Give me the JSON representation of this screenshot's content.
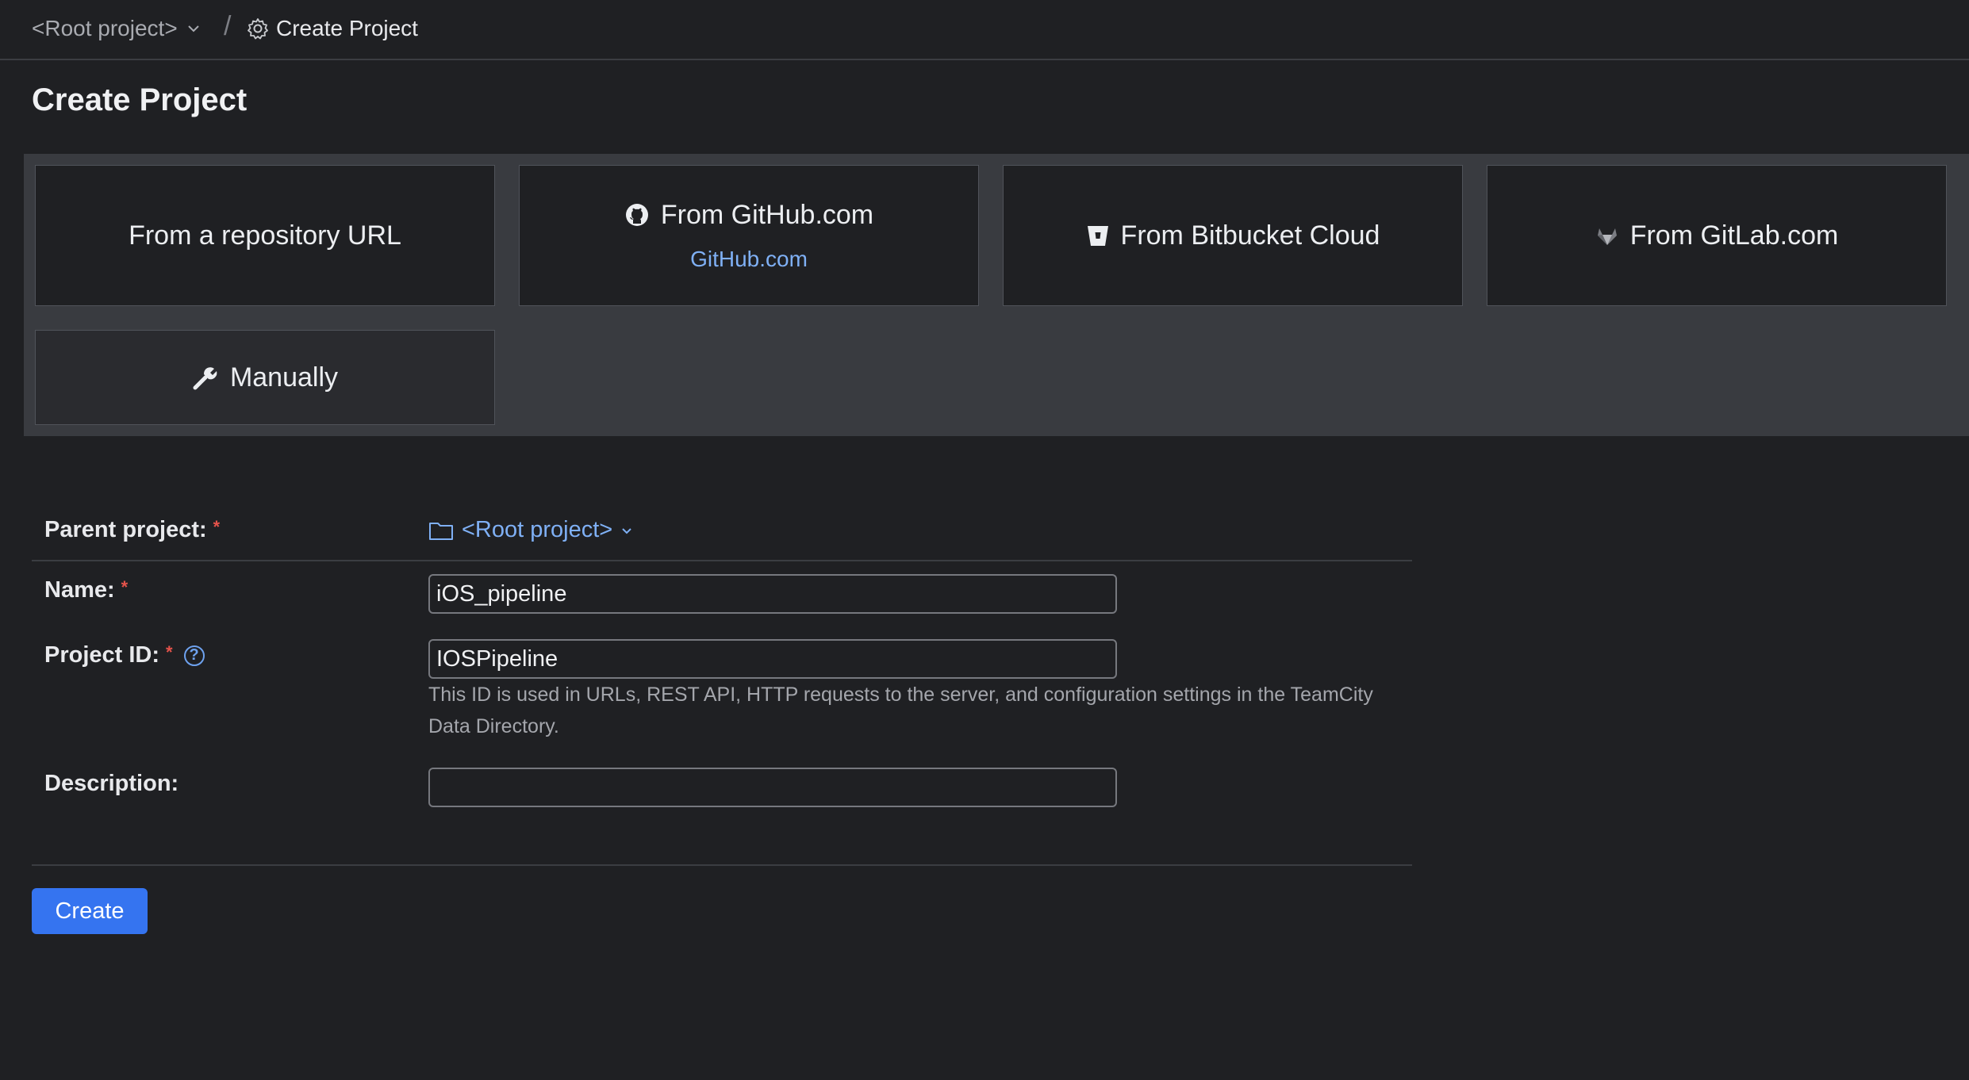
{
  "breadcrumb": {
    "root_label": "<Root project>",
    "separator": "/",
    "current_label": "Create Project"
  },
  "page": {
    "title": "Create Project"
  },
  "import_options": {
    "from_url": "From a repository URL",
    "github": {
      "label": "From GitHub.com",
      "sublabel": "GitHub.com"
    },
    "bitbucket": "From Bitbucket Cloud",
    "gitlab": "From GitLab.com",
    "manual": "Manually"
  },
  "form": {
    "parent": {
      "label": "Parent project:",
      "value": "<Root project>"
    },
    "name": {
      "label": "Name:",
      "value": "iOS_pipeline"
    },
    "project_id": {
      "label": "Project ID:",
      "value": "IOSPipeline",
      "hint": "This ID is used in URLs, REST API, HTTP requests to the server, and configuration settings in the TeamCity Data Directory."
    },
    "description": {
      "label": "Description:",
      "value": ""
    },
    "required_mark": "*",
    "help_glyph": "?"
  },
  "actions": {
    "create_label": "Create"
  },
  "colors": {
    "background": "#1f2023",
    "panel": "#393b40",
    "accent": "#3574f0",
    "link": "#7fb0f5",
    "required": "#e5534b"
  }
}
